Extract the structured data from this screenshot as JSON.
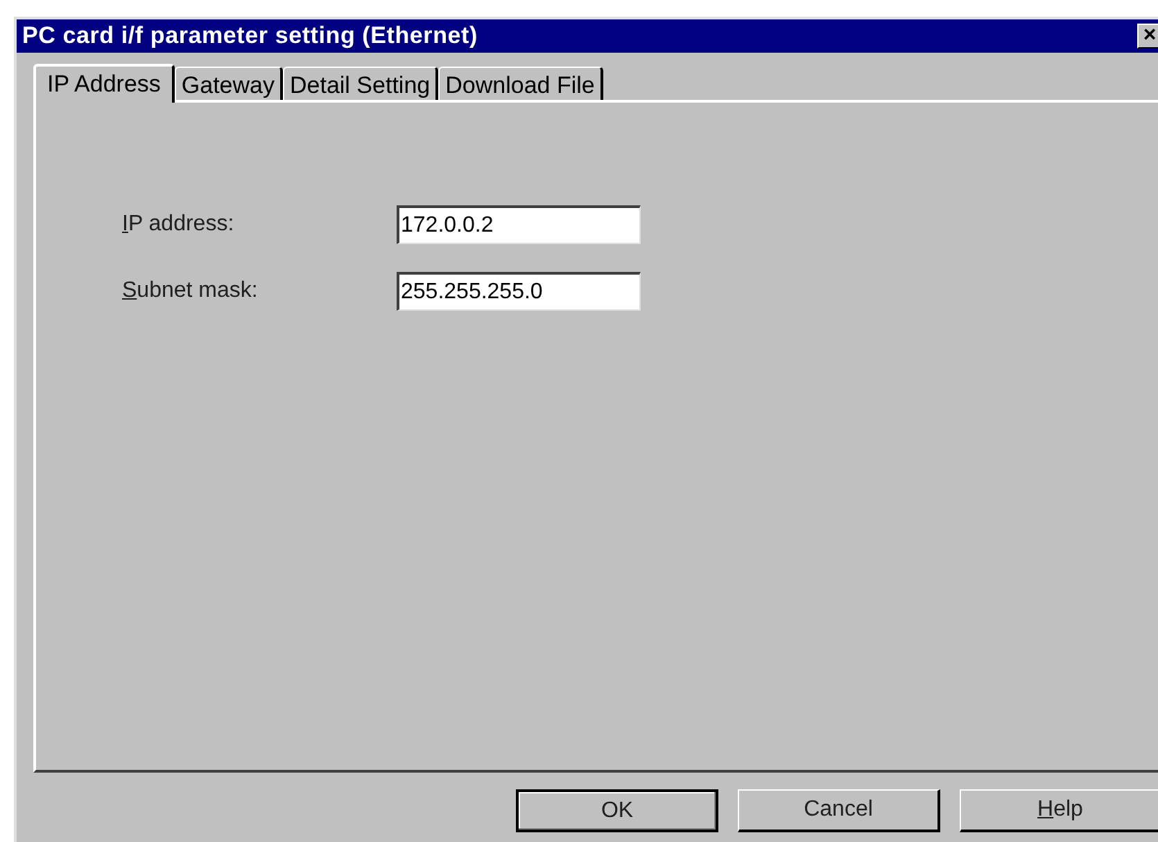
{
  "window": {
    "title": "PC card i/f parameter setting (Ethernet)",
    "close": "×"
  },
  "tabs": [
    {
      "label": "IP Address",
      "selected": true
    },
    {
      "label": "Gateway",
      "selected": false
    },
    {
      "label": "Detail Setting",
      "selected": false
    },
    {
      "label": "Download File",
      "selected": false
    }
  ],
  "fields": [
    {
      "label": "IP address:",
      "mnemonic": true,
      "value": "172.0.0.2"
    },
    {
      "label": "Subnet mask:",
      "mnemonic": true,
      "value": "255.255.255.0"
    }
  ],
  "buttons": [
    {
      "label": "OK",
      "default": true,
      "mnemonic": false
    },
    {
      "label": "Cancel",
      "default": false,
      "mnemonic": false
    },
    {
      "label": "Help",
      "default": false,
      "mnemonic": true
    }
  ]
}
